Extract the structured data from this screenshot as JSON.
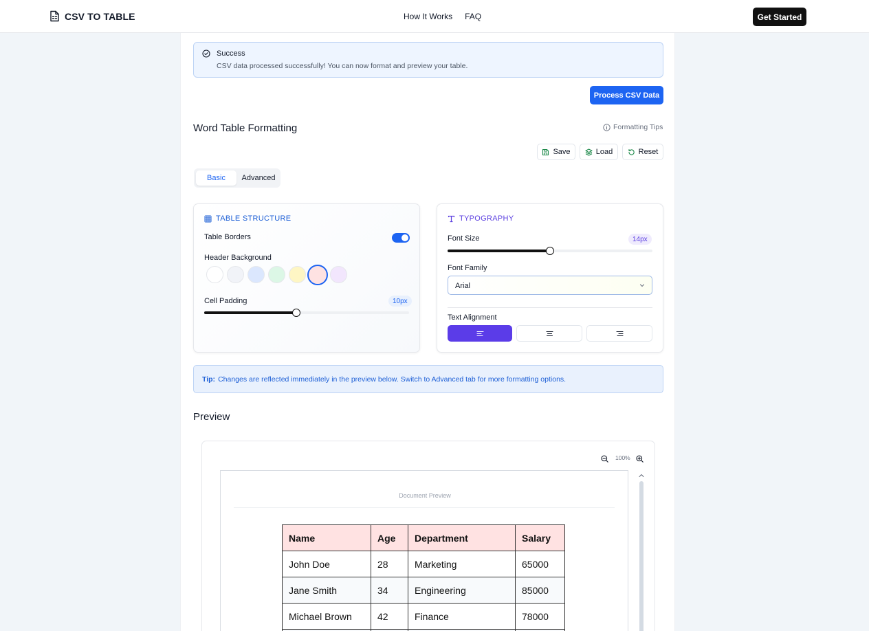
{
  "navbar": {
    "brand": "CSV TO TABLE",
    "brand_icon": "file-spreadsheet-icon",
    "links": [
      "How It Works",
      "FAQ"
    ],
    "cta": "Get Started"
  },
  "alert": {
    "title": "Success",
    "message": "CSV data processed successfully! You can now format and preview your table.",
    "icon": "check-circle-icon"
  },
  "process_button": "Process CSV Data",
  "formatting": {
    "title": "Word Table Formatting",
    "tips_link": "Formatting Tips",
    "actions": {
      "save": "Save",
      "load": "Load",
      "reset": "Reset"
    },
    "tabs": {
      "basic": "Basic",
      "advanced": "Advanced",
      "selected": "Basic"
    }
  },
  "structure": {
    "title": "TABLE STRUCTURE",
    "borders_label": "Table Borders",
    "borders_on": true,
    "header_bg_label": "Header Background",
    "swatch_colors": [
      "#ffffff",
      "#f1f3f8",
      "#dbe7fe",
      "#dcf7e6",
      "#fef6c4",
      "#fee2e2",
      "#f2e6fd"
    ],
    "swatch_selected": "#fee2e2",
    "padding_label": "Cell Padding",
    "padding_value": "10px",
    "padding_fraction": 0.45
  },
  "typography": {
    "title": "TYPOGRAPHY",
    "font_size_label": "Font Size",
    "font_size_value": "14px",
    "font_size_fraction": 0.5,
    "font_family_label": "Font Family",
    "font_family_value": "Arial",
    "alignment_label": "Text Alignment",
    "alignment_options": [
      "left",
      "center",
      "right"
    ],
    "alignment_selected": "left"
  },
  "tip": {
    "prefix": "Tip:",
    "text": "Changes are reflected immediately in the preview below. Switch to Advanced tab for more formatting options."
  },
  "preview": {
    "title": "Preview",
    "zoom": "100%",
    "doc_label": "Document Preview",
    "table": {
      "headers": [
        "Name",
        "Age",
        "Department",
        "Salary"
      ],
      "rows": [
        [
          "John Doe",
          "28",
          "Marketing",
          "65000"
        ],
        [
          "Jane Smith",
          "34",
          "Engineering",
          "85000"
        ],
        [
          "Michael Brown",
          "42",
          "Finance",
          "78000"
        ]
      ]
    }
  }
}
